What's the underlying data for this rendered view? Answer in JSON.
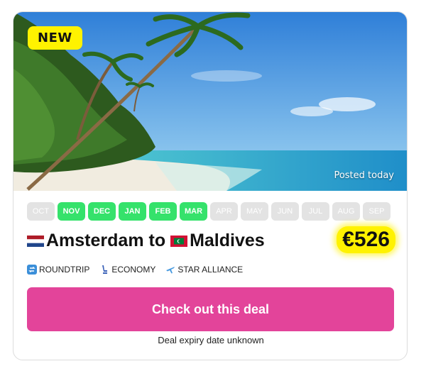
{
  "deal": {
    "badge": "NEW",
    "posted": "Posted today",
    "months": [
      {
        "label": "OCT",
        "active": false
      },
      {
        "label": "NOV",
        "active": true
      },
      {
        "label": "DEC",
        "active": true
      },
      {
        "label": "JAN",
        "active": true
      },
      {
        "label": "FEB",
        "active": true
      },
      {
        "label": "MAR",
        "active": true
      },
      {
        "label": "APR",
        "active": false
      },
      {
        "label": "MAY",
        "active": false
      },
      {
        "label": "JUN",
        "active": false
      },
      {
        "label": "JUL",
        "active": false
      },
      {
        "label": "AUG",
        "active": false
      },
      {
        "label": "SEP",
        "active": false
      }
    ],
    "origin": "Amsterdam",
    "to_word": "to",
    "destination": "Maldives",
    "price": "€526",
    "trip_type": "ROUNDTRIP",
    "cabin": "ECONOMY",
    "alliance": "STAR ALLIANCE",
    "cta_label": "Check out this deal",
    "expiry": "Deal expiry date unknown"
  },
  "colors": {
    "accent": "#e3449a",
    "highlight": "#fff200",
    "month_active": "#35e26b",
    "month_inactive": "#e3e3e3"
  },
  "icons": {
    "origin_flag": "netherlands-flag-icon",
    "destination_flag": "maldives-flag-icon",
    "roundtrip": "roundtrip-icon",
    "cabin": "seat-icon",
    "alliance": "airplane-icon"
  }
}
